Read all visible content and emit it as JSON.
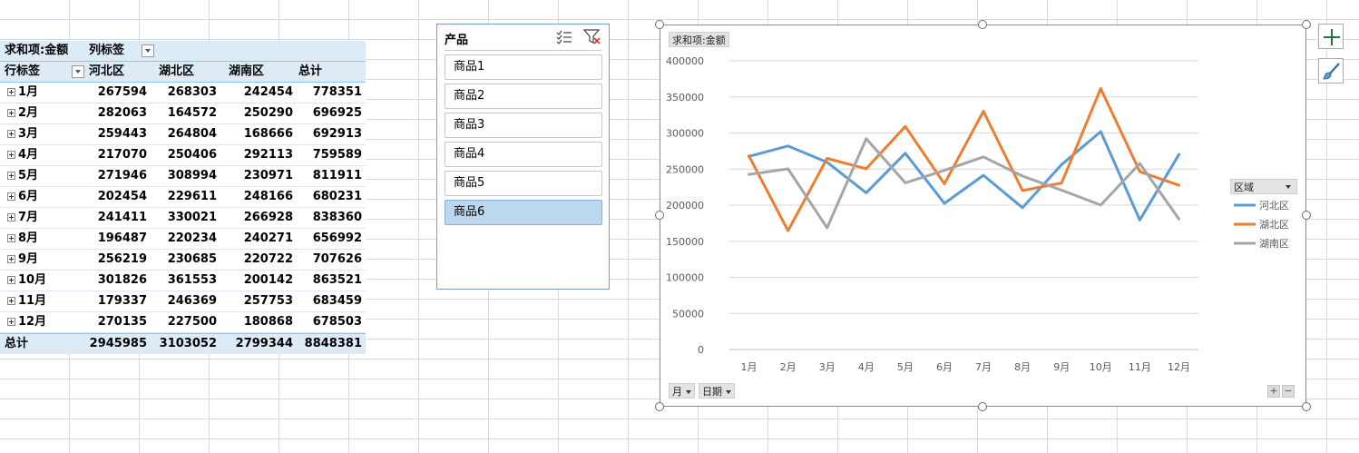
{
  "pivot": {
    "header1": {
      "value_field": "求和项:金额",
      "column_label": "列标签"
    },
    "header2": {
      "row_label": "行标签",
      "columns": [
        "河北区",
        "湖北区",
        "湖南区",
        "总计"
      ]
    },
    "rows": [
      {
        "label": "1月",
        "values": [
          "267594",
          "268303",
          "242454",
          "778351"
        ]
      },
      {
        "label": "2月",
        "values": [
          "282063",
          "164572",
          "250290",
          "696925"
        ]
      },
      {
        "label": "3月",
        "values": [
          "259443",
          "264804",
          "168666",
          "692913"
        ]
      },
      {
        "label": "4月",
        "values": [
          "217070",
          "250406",
          "292113",
          "759589"
        ]
      },
      {
        "label": "5月",
        "values": [
          "271946",
          "308994",
          "230971",
          "811911"
        ]
      },
      {
        "label": "6月",
        "values": [
          "202454",
          "229611",
          "248166",
          "680231"
        ]
      },
      {
        "label": "7月",
        "values": [
          "241411",
          "330021",
          "266928",
          "838360"
        ]
      },
      {
        "label": "8月",
        "values": [
          "196487",
          "220234",
          "240271",
          "656992"
        ]
      },
      {
        "label": "9月",
        "values": [
          "256219",
          "230685",
          "220722",
          "707626"
        ]
      },
      {
        "label": "10月",
        "values": [
          "301826",
          "361553",
          "200142",
          "863521"
        ]
      },
      {
        "label": "11月",
        "values": [
          "179337",
          "246369",
          "257753",
          "683459"
        ]
      },
      {
        "label": "12月",
        "values": [
          "270135",
          "227500",
          "180868",
          "678503"
        ]
      }
    ],
    "total": {
      "label": "总计",
      "values": [
        "2945985",
        "3103052",
        "2799344",
        "8848381"
      ]
    }
  },
  "slicer": {
    "title": "产品",
    "items": [
      {
        "label": "商品1",
        "selected": false
      },
      {
        "label": "商品2",
        "selected": false
      },
      {
        "label": "商品3",
        "selected": false
      },
      {
        "label": "商品4",
        "selected": false
      },
      {
        "label": "商品5",
        "selected": false
      },
      {
        "label": "商品6",
        "selected": true
      }
    ]
  },
  "chart_widgets": {
    "value_chip": "求和项:金额",
    "legend_chip": "区域",
    "axis_chips": [
      "月",
      "日期"
    ],
    "zoom_in": "+",
    "zoom_out": "−"
  },
  "chart_data": {
    "type": "line",
    "categories": [
      "1月",
      "2月",
      "3月",
      "4月",
      "5月",
      "6月",
      "7月",
      "8月",
      "9月",
      "10月",
      "11月",
      "12月"
    ],
    "yticks": [
      "0",
      "50000",
      "100000",
      "150000",
      "200000",
      "250000",
      "300000",
      "350000",
      "400000"
    ],
    "ylim": [
      0,
      400000
    ],
    "grid": true,
    "legend_position": "right",
    "series": [
      {
        "name": "河北区",
        "color": "#5b9bd5",
        "values": [
          267594,
          282063,
          259443,
          217070,
          271946,
          202454,
          241411,
          196487,
          256219,
          301826,
          179337,
          270135
        ]
      },
      {
        "name": "湖北区",
        "color": "#ed7d31",
        "values": [
          268303,
          164572,
          264804,
          250406,
          308994,
          229611,
          330021,
          220234,
          230685,
          361553,
          246369,
          227500
        ]
      },
      {
        "name": "湖南区",
        "color": "#a5a5a5",
        "values": [
          242454,
          250290,
          168666,
          292113,
          230971,
          248166,
          266928,
          240271,
          220722,
          200142,
          257753,
          180868
        ]
      }
    ]
  }
}
